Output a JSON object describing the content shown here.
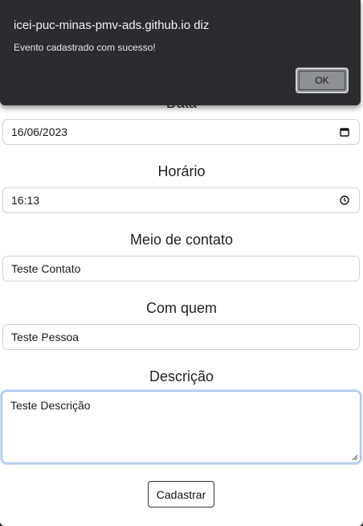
{
  "dialog": {
    "title": "icei-puc-minas-pmv-ads.github.io diz",
    "message": "Evento cadastrado com sucesso!",
    "ok_label": "OK"
  },
  "form": {
    "data_label": "Data",
    "data_value": "16/06/2023",
    "horario_label": "Horário",
    "horario_value": "16:13",
    "meio_label": "Meio de contato",
    "meio_value": "Teste Contato",
    "com_quem_label": "Com quem",
    "com_quem_value": "Teste Pessoa",
    "descricao_label": "Descrição",
    "descricao_value": "Teste Descrição",
    "submit_label": "Cadastrar"
  },
  "icons": {
    "date": "calendar-icon",
    "time": "clock-icon"
  }
}
